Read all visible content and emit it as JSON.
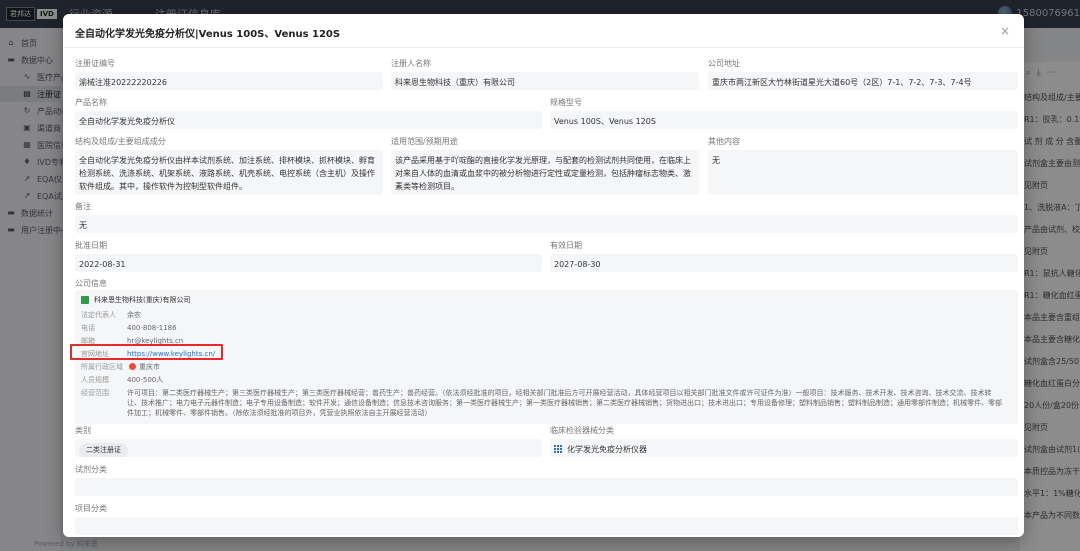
{
  "app": {
    "brand_a": "君邦达",
    "brand_b": "IVD",
    "nav_items": [
      "行业资源",
      "注册证信息库"
    ],
    "user": "1580076961"
  },
  "sidebar": {
    "items": [
      {
        "label": "首页",
        "icon": "home-icon"
      },
      {
        "label": "数据中心",
        "icon": "folder-icon"
      },
      {
        "label": "医疗产品",
        "icon": "chart-icon"
      },
      {
        "label": "注册证",
        "icon": "doc-icon"
      },
      {
        "label": "产品动态",
        "icon": "refresh-icon"
      },
      {
        "label": "渠道商",
        "icon": "briefcase-icon"
      },
      {
        "label": "医院信息",
        "icon": "building-icon"
      },
      {
        "label": "IVD专利",
        "icon": "bulb-icon"
      },
      {
        "label": "EQA仪器",
        "icon": "trend-icon"
      },
      {
        "label": "EQA试剂",
        "icon": "trend-icon"
      },
      {
        "label": "数据统计",
        "icon": "folder-icon"
      },
      {
        "label": "用户注册中心",
        "icon": "folder-icon"
      }
    ],
    "footer": "Powered by 科来恩"
  },
  "background": {
    "rows": [
      "结构及组成/主要",
      "R1：胶乳：0.1%",
      "试 剂 成 分 含量",
      "试剂盒主要由测",
      "见附页",
      "1、洗脱液A：了",
      "产品由试剂、校",
      "见附页",
      "R1：鼠抗人糖化",
      "R1：糖化血红蛋",
      "本品主要含重组",
      "本品主要含糖化",
      "试剂盒含25/50",
      "糖化血红蛋白分",
      "20人份/盒20份",
      "见附页",
      "试剂盒由试剂1(R",
      "本质控品为冻干",
      "水平1：1%糖化",
      "本产品为不同数"
    ]
  },
  "modal": {
    "title": "全自动化学发光免疫分析仪|Venus 100S、Venus 120S",
    "close_icon": "×",
    "fields": {
      "reg_no": {
        "label": "注册证编号",
        "value": "渝械注准20222220226"
      },
      "registrant": {
        "label": "注册人名称",
        "value": "科来恩生物科技（重庆）有限公司"
      },
      "address": {
        "label": "公司地址",
        "value": "重庆市两江新区大竹林街道星光大道60号（2区）7-1、7-2、7-3、7-4号"
      },
      "product_name": {
        "label": "产品名称",
        "value": "全自动化学发光免疫分析仪"
      },
      "spec": {
        "label": "规格型号",
        "value": "Venus 100S、Venus 120S"
      },
      "structure": {
        "label": "结构及组成/主要组成成分",
        "value": "全自动化学发光免疫分析仪由样本试剂系统、加注系统、排杯模块、抓杯模块、孵育检测系统、洗涤系统、机架系统、液路系统、机壳系统、电控系统（含主机）及操作软件组成。其中，操作软件为控制型软件组件。"
      },
      "scope": {
        "label": "适用范围/预期用途",
        "value": "该产品采用基于吖啶酯的直接化学发光原理，与配套的检测试剂共同使用，在临床上对来自人体的血清或血浆中的被分析物进行定性或定量检测，包括肿瘤标志物类、激素类等检测项目。"
      },
      "other": {
        "label": "其他内容",
        "value": "无"
      },
      "remark": {
        "label": "备注",
        "value": "无"
      },
      "approve_date": {
        "label": "批准日期",
        "value": "2022-08-31"
      },
      "valid_date": {
        "label": "有效日期",
        "value": "2027-08-30"
      },
      "category": {
        "label": "类别",
        "value": "二类注册证"
      },
      "clinical": {
        "label": "临床检验器械分类",
        "value": "化学发光免疫分析仪器"
      },
      "reagent_cat": {
        "label": "试剂分类",
        "value": ""
      },
      "project_cat": {
        "label": "项目分类",
        "value": ""
      }
    },
    "company": {
      "section_label": "公司信息",
      "name": "科来恩生物科技(重庆)有限公司",
      "rows": [
        {
          "k": "法定代表人",
          "v": "余农"
        },
        {
          "k": "电话",
          "v": "400-808-1186"
        },
        {
          "k": "邮箱",
          "v": "hr@keylights.cn"
        },
        {
          "k": "官网地址",
          "v": "https://www.keylights.cn/"
        },
        {
          "k": "所属行政区域",
          "v": "重庆市"
        },
        {
          "k": "人员规模",
          "v": "400-500人"
        },
        {
          "k": "经营范围",
          "v": "许可项目：第二类医疗器械生产；第三类医疗器械生产；第三类医疗器械经营；兽药生产；兽药经营。（依法须经批准的项目，经相关部门批准后方可开展经营活动，具体经营项目以相关部门批准文件或许可证件为准）一般项目：技术服务、技术开发、技术咨询、技术交流、技术转让、技术推广；电力电子元器件制造；电子专用设备制造；软件开发；通信设备制造；信息技术咨询服务；第一类医疗器械生产；第一类医疗器械销售；第二类医疗器械销售；货物进出口；技术进出口；专用设备修理；塑料制品销售；塑料制品制造；通用零部件制造；机械零件、零部件加工；机械零件、零部件销售。（除依法须经批准的项目外，凭营业执照依法自主开展经营活动）"
        }
      ]
    }
  }
}
